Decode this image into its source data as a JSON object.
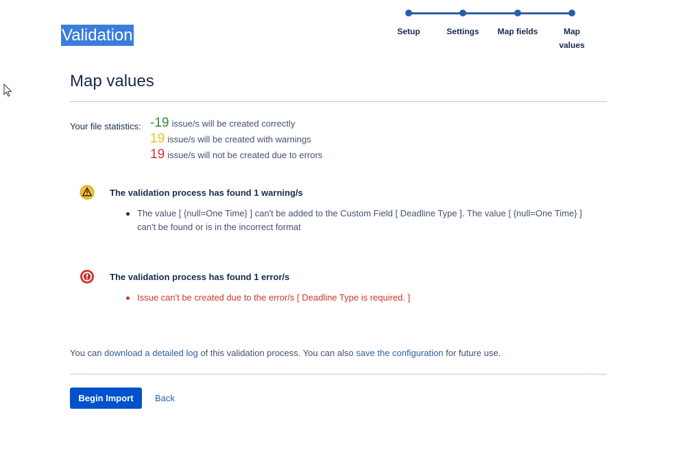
{
  "header": {
    "title": "Validation"
  },
  "stepper": {
    "steps": [
      {
        "label": "Setup"
      },
      {
        "label": "Settings"
      },
      {
        "label": "Map fields"
      },
      {
        "label": "Map values"
      }
    ]
  },
  "main": {
    "section_title": "Map values",
    "stats_label": "Your file statistics:",
    "stats": [
      {
        "count": "-19",
        "text": "issue/s will be created correctly"
      },
      {
        "count": "19",
        "text": "issue/s will be created with warnings"
      },
      {
        "count": "19",
        "text": "issue/s will not be created due to errors"
      }
    ],
    "warnings": {
      "title": "The validation process has found 1 warning/s",
      "items": [
        "The value [ {null=One Time} ] can't be added to the Custom Field [ Deadline Type ]. The value [ {null=One Time} ] can't be found or is in the incorrect format"
      ]
    },
    "errors": {
      "title": "The validation process has found 1 error/s",
      "items": [
        "Issue can't be created due to the error/s [ Deadline Type is required. ]"
      ]
    },
    "footer": {
      "text1": "You can ",
      "link1": "download a detailed log",
      "text2": " of this validation process. You can also ",
      "link2": "save the configuration",
      "text3": " for future use."
    }
  },
  "actions": {
    "primary_label": "Begin Import",
    "back_label": "Back"
  },
  "colors": {
    "accent": "#0052cc",
    "success": "#2e8b2e",
    "warning": "#e8c11c",
    "error": "#c9372c"
  },
  "icons": {
    "warning": "warning-icon",
    "error": "error-icon",
    "cursor": "mouse-pointer-icon"
  }
}
